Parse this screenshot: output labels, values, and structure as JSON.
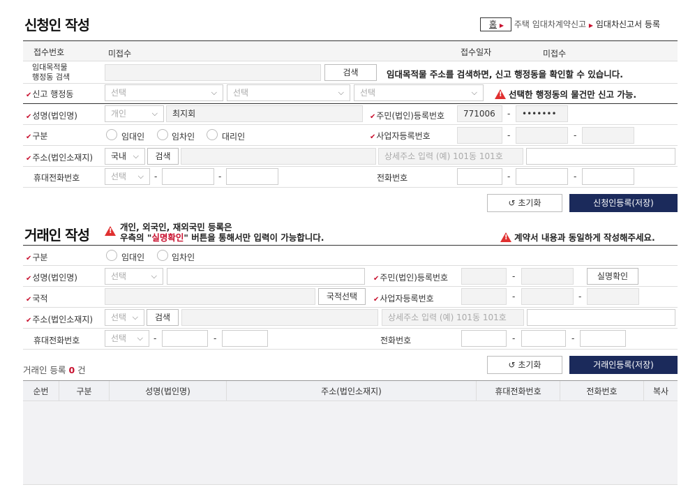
{
  "applicant": {
    "title": "신청인 작성",
    "breadcrumb": {
      "home": "홈",
      "level1": "주택 임대차계약신고",
      "level2": "임대차신고서 등록"
    },
    "receipt_no_label": "접수번호",
    "receipt_no_value": "미접수",
    "receipt_date_label": "접수일자",
    "receipt_date_value": "미접수",
    "property_search_label_1": "임대목적물",
    "property_search_label_2": "행정동 검색",
    "search_button": "검색",
    "property_search_hint": "임대목적물 주소를 검색하면, 신고 행정동을 확인할 수 있습니다.",
    "district_label": "신고 행정동",
    "select_placeholder": "선택",
    "district_warning": "선택한 행정동의 물건만 신고 가능.",
    "name_label": "성명(법인명)",
    "person_type": "개인",
    "name_value": "최지회",
    "rrn_label": "주민(법인)등록번호",
    "rrn_front": "771006",
    "rrn_back": "•••••••",
    "category_label": "구분",
    "radio_lessor": "임대인",
    "radio_lessee": "임차인",
    "radio_agent": "대리인",
    "bizno_label": "사업자등록번호",
    "address_label": "주소(법인소재지)",
    "country_value": "국내",
    "address_detail_placeholder": "상세주소 입력 (예) 101동 101호",
    "mobile_label": "휴대전화번호",
    "phone_label": "전화번호",
    "reset_button": "초기화",
    "save_button": "신청인등록(저장)"
  },
  "party": {
    "title": "거래인 작성",
    "note_line1": "개인, 외국인, 재외국민 등록은",
    "note_line2_a": "우측의 \"",
    "note_line2_b": "실명확인",
    "note_line2_c": "\" 버튼을 통해서만 입력이 가능합니다.",
    "right_warning": "계약서 내용과 동일하게 작성해주세요.",
    "category_label": "구분",
    "radio_lessor": "임대인",
    "radio_lessee": "임차인",
    "name_label": "성명(법인명)",
    "select_placeholder": "선택",
    "rrn_label": "주민(법인)등록번호",
    "verify_button": "실명확인",
    "nationality_label": "국적",
    "nationality_button": "국적선택",
    "bizno_label": "사업자등록번호",
    "address_label": "주소(법인소재지)",
    "search_button": "검색",
    "address_detail_placeholder": "상세주소 입력 (예) 101동 101호",
    "mobile_label": "휴대전화번호",
    "phone_label": "전화번호",
    "count_prefix": "거래인 등록",
    "count_value": "0",
    "count_suffix": "건",
    "reset_button": "초기화",
    "save_button": "거래인등록(저장)",
    "columns": [
      "순번",
      "구분",
      "성명(법인명)",
      "주소(법인소재지)",
      "휴대전화번호",
      "전화번호",
      "복사"
    ]
  },
  "colors": {
    "accent": "#c8102e",
    "navy": "#1b2a5b",
    "warning": "#e03030"
  }
}
